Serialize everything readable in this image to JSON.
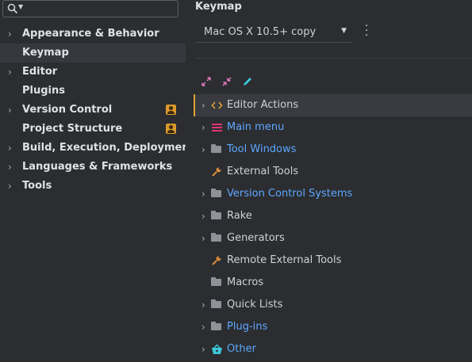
{
  "sidebar": {
    "items": [
      {
        "label": "Appearance & Behavior",
        "expandable": true,
        "selected": false,
        "badge": false
      },
      {
        "label": "Keymap",
        "expandable": false,
        "selected": true,
        "badge": false
      },
      {
        "label": "Editor",
        "expandable": true,
        "selected": false,
        "badge": false
      },
      {
        "label": "Plugins",
        "expandable": false,
        "selected": false,
        "badge": false
      },
      {
        "label": "Version Control",
        "expandable": true,
        "selected": false,
        "badge": true
      },
      {
        "label": "Project Structure",
        "expandable": false,
        "selected": false,
        "badge": true
      },
      {
        "label": "Build, Execution, Deployment",
        "expandable": true,
        "selected": false,
        "badge": false
      },
      {
        "label": "Languages & Frameworks",
        "expandable": true,
        "selected": false,
        "badge": false
      },
      {
        "label": "Tools",
        "expandable": true,
        "selected": false,
        "badge": false
      }
    ]
  },
  "main": {
    "title": "Keymap",
    "keymap_select": {
      "value": "Mac OS X 10.5+ copy"
    },
    "actions": [
      {
        "label": "Editor Actions",
        "icon": "code-brackets-icon",
        "expandable": true,
        "color": "gray",
        "selected": true
      },
      {
        "label": "Main menu",
        "icon": "menu-lines-icon",
        "expandable": true,
        "color": "blue",
        "selected": false
      },
      {
        "label": "Tool Windows",
        "icon": "folder-icon",
        "expandable": true,
        "color": "blue",
        "selected": false
      },
      {
        "label": "External Tools",
        "icon": "wrench-icon",
        "expandable": false,
        "color": "gray",
        "selected": false
      },
      {
        "label": "Version Control Systems",
        "icon": "folder-icon",
        "expandable": true,
        "color": "blue",
        "selected": false
      },
      {
        "label": "Rake",
        "icon": "folder-icon",
        "expandable": true,
        "color": "gray",
        "selected": false
      },
      {
        "label": "Generators",
        "icon": "folder-icon",
        "expandable": true,
        "color": "gray",
        "selected": false
      },
      {
        "label": "Remote External Tools",
        "icon": "wrench-icon",
        "expandable": false,
        "color": "gray",
        "selected": false
      },
      {
        "label": "Macros",
        "icon": "folder-icon",
        "expandable": false,
        "color": "gray",
        "selected": false
      },
      {
        "label": "Quick Lists",
        "icon": "folder-icon",
        "expandable": true,
        "color": "gray",
        "selected": false
      },
      {
        "label": "Plug-ins",
        "icon": "folder-icon",
        "expandable": true,
        "color": "blue",
        "selected": false
      },
      {
        "label": "Other",
        "icon": "basket-icon",
        "expandable": true,
        "color": "blue",
        "selected": false
      }
    ]
  },
  "colors": {
    "accent": "#e0a133",
    "link": "#5ea7ff",
    "background": "#2b2d30"
  }
}
